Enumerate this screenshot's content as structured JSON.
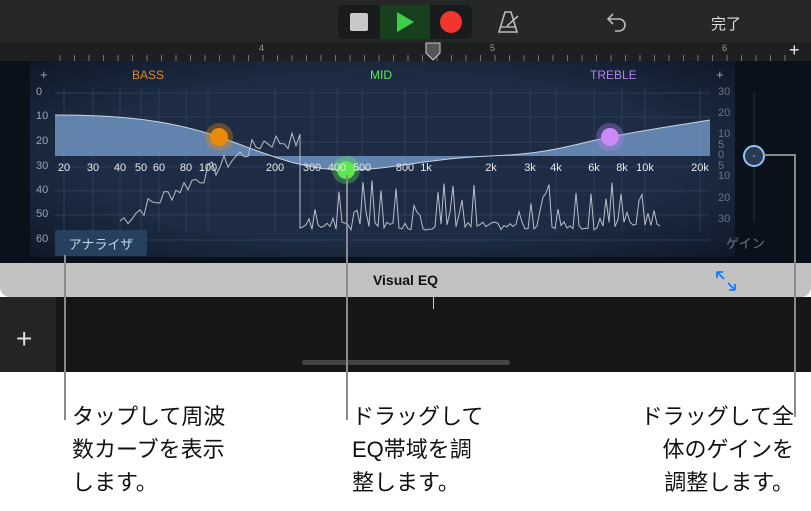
{
  "toolbar": {
    "stop": "stop",
    "play": "play",
    "record": "record",
    "done_label": "完了"
  },
  "ruler": {
    "bar_numbers": [
      "4",
      "5",
      "6"
    ]
  },
  "eq": {
    "bands": [
      {
        "name": "BASS",
        "color": "#e88a0c"
      },
      {
        "name": "MID",
        "color": "#5ce84f"
      },
      {
        "name": "TREBLE",
        "color": "#b47ff0"
      }
    ],
    "plus_left": "+",
    "plus_right": "+",
    "left_scale": [
      "0",
      "10",
      "20",
      "30",
      "40",
      "50",
      "60"
    ],
    "right_scale": [
      "30",
      "20",
      "10",
      "5",
      "0",
      "5",
      "10",
      "20",
      "30"
    ],
    "freq_labels": [
      "20",
      "30",
      "40",
      "50",
      "60",
      "80",
      "100",
      "200",
      "300",
      "400",
      "500",
      "800",
      "1k",
      "2k",
      "3k",
      "4k",
      "6k",
      "8k",
      "10k",
      "20k"
    ],
    "analyzer_label": "アナライザ",
    "gain_label": "ゲイン"
  },
  "visual_eq_bar": {
    "title": "Visual EQ"
  },
  "callouts": [
    {
      "lines": [
        "タップして周波",
        "数カーブを表示",
        "します。"
      ]
    },
    {
      "lines": [
        "ドラッグして",
        "EQ帯域を調",
        "整します。"
      ]
    },
    {
      "lines": [
        "ドラッグして全",
        "体のゲインを",
        "調整します。"
      ]
    }
  ]
}
